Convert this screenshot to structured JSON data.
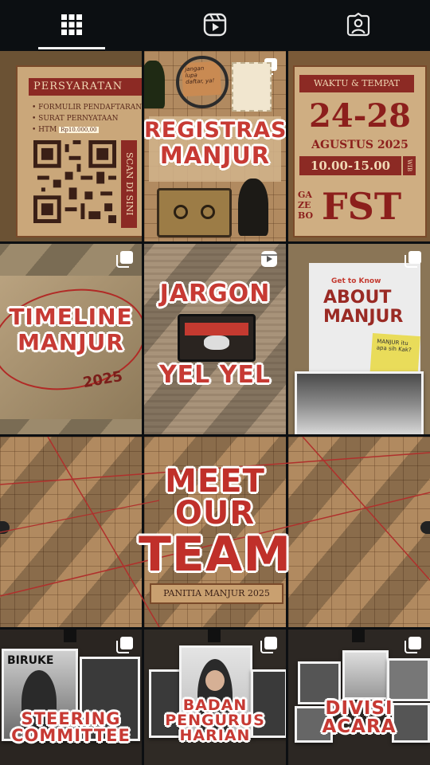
{
  "tabs": [
    {
      "name": "grid-icon",
      "active": true
    },
    {
      "name": "reels-icon",
      "active": false
    },
    {
      "name": "tagged-icon",
      "active": false
    }
  ],
  "posts": {
    "p1": {
      "left_title": "PERSYARATAN",
      "left_items": [
        "• FORMULIR PENDAFTARAN",
        "• SURAT PERNYATAAN",
        "• HTM"
      ],
      "htm_value": "Rp10.000,00",
      "scan_label": "SCAN DI SINI"
    },
    "p2": {
      "note_text": "jangan lupa daftar, ya!",
      "title_line1": "REGISTRASI",
      "title_line2": "MANJUR"
    },
    "p3": {
      "header": "WAKTU & TEMPAT",
      "date": "24-28",
      "month": "AGUSTUS 2025",
      "time": "10.00-15.00",
      "tz": "WIB",
      "place_small": "GA ZE BO",
      "place_big": "FST"
    },
    "p4": {
      "line1": "TIMELINE",
      "line2": "MANJUR",
      "year": "2025"
    },
    "p5": {
      "line1": "JARGON",
      "line2": "YEL YEL"
    },
    "p6": {
      "small": "Get to Know",
      "line1": "ABOUT",
      "line2": "MANJUR",
      "sticky": "MANJUR itu apa sih Kak?"
    },
    "p7": {
      "line1": "MEET OUR",
      "line2": "TEAM",
      "plate": "PANITIA MANJUR 2025"
    },
    "p8": {
      "line1": "STEERING",
      "line2": "COMMITTEE",
      "board": "BIRUKE"
    },
    "p9": {
      "line1": "BADAN",
      "line2": "PENGURUS",
      "line3": "HARIAN"
    },
    "p10": {
      "line1": "DIVISI",
      "line2": "ACARA"
    }
  },
  "colors": {
    "bg": "#0c0f12",
    "stamp_red": "#c73a34",
    "paper": "#d9c09a"
  }
}
